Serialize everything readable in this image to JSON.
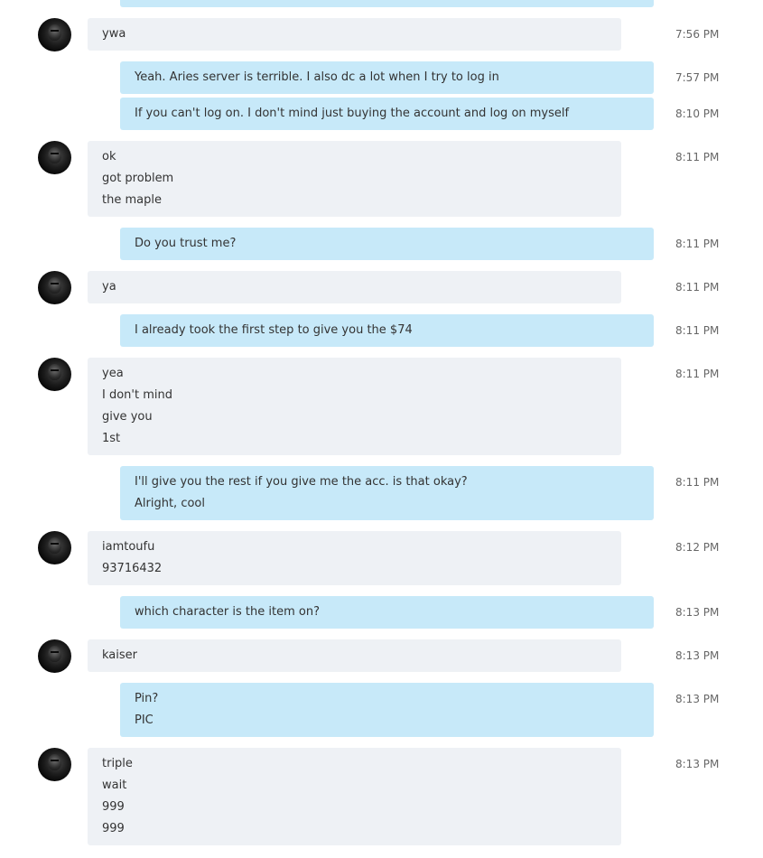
{
  "conversation": [
    {
      "sender": "self",
      "time": "",
      "lines": []
    },
    {
      "sender": "other",
      "time": "7:56 PM",
      "lines": [
        "ywa"
      ]
    },
    {
      "sender": "self",
      "time": "7:57 PM",
      "lines": [
        "Yeah. Aries server is terrible. I also dc a lot when I try to log in"
      ]
    },
    {
      "sender": "self",
      "time": "8:10 PM",
      "lines": [
        "If you can't log on. I don't mind just buying the account and log on myself"
      ]
    },
    {
      "sender": "other",
      "time": "8:11 PM",
      "lines": [
        "ok",
        "got problem",
        "the maple"
      ]
    },
    {
      "sender": "self",
      "time": "8:11 PM",
      "lines": [
        "Do you trust me?"
      ]
    },
    {
      "sender": "other",
      "time": "8:11 PM",
      "lines": [
        "ya"
      ]
    },
    {
      "sender": "self",
      "time": "8:11 PM",
      "lines": [
        "I already took the first step to give you the $74"
      ]
    },
    {
      "sender": "other",
      "time": "8:11 PM",
      "lines": [
        "yea",
        "I don't mind",
        "give you",
        "1st"
      ]
    },
    {
      "sender": "self",
      "time": "8:11 PM",
      "lines": [
        "I'll give you the rest if you give me the acc. is that okay?",
        "Alright, cool"
      ]
    },
    {
      "sender": "other",
      "time": "8:12 PM",
      "lines": [
        "iamtoufu",
        "93716432"
      ]
    },
    {
      "sender": "self",
      "time": "8:13 PM",
      "lines": [
        "which character is the item on?"
      ]
    },
    {
      "sender": "other",
      "time": "8:13 PM",
      "lines": [
        "kaiser"
      ]
    },
    {
      "sender": "self",
      "time": "8:13 PM",
      "lines": [
        "Pin?",
        "PIC"
      ]
    },
    {
      "sender": "other",
      "time": "8:13 PM",
      "lines": [
        "triple",
        "wait",
        "999",
        "999"
      ]
    }
  ]
}
